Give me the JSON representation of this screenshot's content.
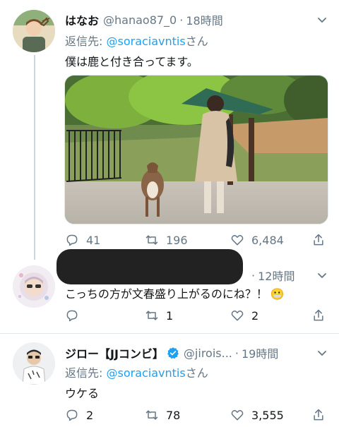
{
  "tweets": [
    {
      "name": "はなお",
      "handle": "@hanao87_0",
      "time": "18時間",
      "reply_prefix": "返信先: ",
      "reply_mention": "@soraciavntis",
      "reply_suffix": "さん",
      "text": "僕は鹿と付き合ってます。",
      "reply_count": "41",
      "retweet_count": "196",
      "like_count": "6,484"
    },
    {
      "time": "12時間",
      "text": "こっちの方が文春盛り上がるのにね？！",
      "emoji": "😬",
      "reply_count": "",
      "retweet_count": "1",
      "like_count": "2"
    },
    {
      "name": "ジロー【JJコンビ】",
      "handle": "@jirois...",
      "time": "19時間",
      "reply_prefix": "返信先: ",
      "reply_mention": "@soraciavntis",
      "reply_suffix": "さん",
      "text": "ウケる",
      "reply_count": "2",
      "retweet_count": "78",
      "like_count": "3,555"
    }
  ],
  "icons": [
    "reply-icon",
    "retweet-icon",
    "like-icon",
    "share-icon",
    "chevron-down-icon",
    "verified-badge-icon"
  ],
  "colors": {
    "link": "#1da1f2",
    "muted": "#657786",
    "verified": "#1da1f2",
    "redaction": "#222222"
  }
}
